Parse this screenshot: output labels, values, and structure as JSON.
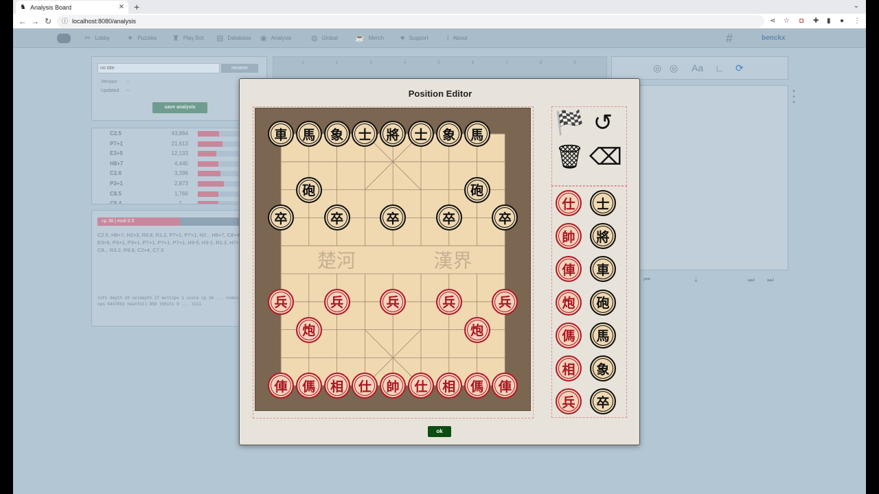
{
  "browser": {
    "tab_title": "Analysis Board",
    "tab_close": "✕",
    "new_tab": "+",
    "url": "localhost:8080/analysis",
    "back": "←",
    "forward": "→",
    "reload": "↻"
  },
  "nav": {
    "items": [
      {
        "label": "Lobby",
        "icon": "✂"
      },
      {
        "label": "Puzzles",
        "icon": "✦"
      },
      {
        "label": "Play Bot",
        "icon": "♜"
      },
      {
        "label": "Database",
        "icon": "▤"
      },
      {
        "label": "Analysis",
        "icon": "◉"
      },
      {
        "label": "Global",
        "icon": "◍"
      },
      {
        "label": "Merch",
        "icon": "☕"
      },
      {
        "label": "Support",
        "icon": "♥"
      },
      {
        "label": "About",
        "icon": "i"
      }
    ],
    "username": "benckx"
  },
  "analysis_panel": {
    "title_placeholder": "no title",
    "rename_label": "rename",
    "version_label": "Version",
    "version_value": "--",
    "updated_label": "Updated",
    "updated_value": "--",
    "save_label": "save analysis"
  },
  "moves": [
    {
      "move": "C2.5",
      "count": "43,884",
      "bar": 0.31
    },
    {
      "move": "P7+1",
      "count": "21,613",
      "bar": 0.36
    },
    {
      "move": "E3+5",
      "count": "12,133",
      "bar": 0.27
    },
    {
      "move": "H8+7",
      "count": "4,445",
      "bar": 0.3
    },
    {
      "move": "C2.6",
      "count": "3,396",
      "bar": 0.33
    },
    {
      "move": "P3+1",
      "count": "2,873",
      "bar": 0.38
    },
    {
      "move": "C8.5",
      "count": "1,766",
      "bar": 0.3
    },
    {
      "move": "C8.4",
      "count": "1,...",
      "bar": 0.3
    }
  ],
  "engine": {
    "eval_label": "cp 36 | eval 0.5",
    "eval_fraction": 0.5,
    "pv": "C2.5, H8+7, H2+3, R9.8, R1.2, P7+1, P7+1, H2... H8+7, C8+4, C8+2, E3+5, P3+1, P3+1, P7+1, P7+1, P7+1, H3-5, H3-1, R1.3, H7+6, C8-1, C8... R3.2, R9.8, C2+4, C7.3",
    "info": "info depth 20 seldepth 27 multipv 1 score cp 36 ... nodes 7163687 nps 6447093 hashfull 950 tbhits 0 ... 1111"
  },
  "board_columns": [
    "1",
    "2",
    "3",
    "4",
    "5",
    "6",
    "7",
    "8",
    "9"
  ],
  "modal": {
    "title": "Position Editor",
    "ok_label": "ok",
    "river_left": "楚河",
    "river_right": "漢界",
    "tools": [
      {
        "name": "start-position-flag-icon",
        "glyph": "🏁"
      },
      {
        "name": "undo-icon",
        "glyph": "↺"
      },
      {
        "name": "trash-icon",
        "glyph": "🗑"
      },
      {
        "name": "eraser-icon",
        "glyph": "⌫"
      }
    ],
    "pieces": [
      {
        "char": "車",
        "color": "black",
        "col": 0,
        "row": 0
      },
      {
        "char": "馬",
        "color": "black",
        "col": 1,
        "row": 0
      },
      {
        "char": "象",
        "color": "black",
        "col": 2,
        "row": 0
      },
      {
        "char": "士",
        "color": "black",
        "col": 3,
        "row": 0
      },
      {
        "char": "將",
        "color": "black",
        "col": 4,
        "row": 0
      },
      {
        "char": "士",
        "color": "black",
        "col": 5,
        "row": 0
      },
      {
        "char": "象",
        "color": "black",
        "col": 6,
        "row": 0
      },
      {
        "char": "馬",
        "color": "black",
        "col": 7,
        "row": 0
      },
      {
        "char": "砲",
        "color": "black",
        "col": 1,
        "row": 2
      },
      {
        "char": "砲",
        "color": "black",
        "col": 7,
        "row": 2
      },
      {
        "char": "卒",
        "color": "black",
        "col": 0,
        "row": 3
      },
      {
        "char": "卒",
        "color": "black",
        "col": 2,
        "row": 3
      },
      {
        "char": "卒",
        "color": "black",
        "col": 4,
        "row": 3
      },
      {
        "char": "卒",
        "color": "black",
        "col": 6,
        "row": 3
      },
      {
        "char": "卒",
        "color": "black",
        "col": 8,
        "row": 3
      },
      {
        "char": "兵",
        "color": "red",
        "col": 0,
        "row": 6
      },
      {
        "char": "兵",
        "color": "red",
        "col": 2,
        "row": 6
      },
      {
        "char": "兵",
        "color": "red",
        "col": 4,
        "row": 6
      },
      {
        "char": "兵",
        "color": "red",
        "col": 6,
        "row": 6
      },
      {
        "char": "兵",
        "color": "red",
        "col": 8,
        "row": 6
      },
      {
        "char": "炮",
        "color": "red",
        "col": 1,
        "row": 7
      },
      {
        "char": "炮",
        "color": "red",
        "col": 7,
        "row": 7
      },
      {
        "char": "俥",
        "color": "red",
        "col": 0,
        "row": 9
      },
      {
        "char": "傌",
        "color": "red",
        "col": 1,
        "row": 9
      },
      {
        "char": "相",
        "color": "red",
        "col": 2,
        "row": 9
      },
      {
        "char": "仕",
        "color": "red",
        "col": 3,
        "row": 9
      },
      {
        "char": "帥",
        "color": "red",
        "col": 4,
        "row": 9
      },
      {
        "char": "仕",
        "color": "red",
        "col": 5,
        "row": 9
      },
      {
        "char": "相",
        "color": "red",
        "col": 6,
        "row": 9
      },
      {
        "char": "傌",
        "color": "red",
        "col": 7,
        "row": 9
      },
      {
        "char": "俥",
        "color": "red",
        "col": 8,
        "row": 9
      }
    ],
    "palette": [
      {
        "red": "仕",
        "black": "士"
      },
      {
        "red": "帥",
        "black": "將"
      },
      {
        "red": "俥",
        "black": "車"
      },
      {
        "red": "炮",
        "black": "砲"
      },
      {
        "red": "傌",
        "black": "馬"
      },
      {
        "red": "相",
        "black": "象"
      },
      {
        "red": "兵",
        "black": "卒"
      }
    ]
  }
}
